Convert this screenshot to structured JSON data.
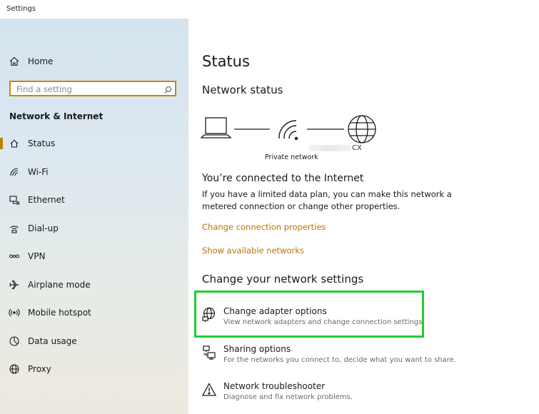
{
  "window": {
    "title": "Settings"
  },
  "sidebar": {
    "home_label": "Home",
    "search_placeholder": "Find a setting",
    "section_heading": "Network & Internet",
    "items": [
      {
        "label": "Status",
        "icon": "home-status-icon",
        "active": true
      },
      {
        "label": "Wi-Fi",
        "icon": "wifi-icon"
      },
      {
        "label": "Ethernet",
        "icon": "ethernet-icon"
      },
      {
        "label": "Dial-up",
        "icon": "dialup-icon"
      },
      {
        "label": "VPN",
        "icon": "vpn-icon"
      },
      {
        "label": "Airplane mode",
        "icon": "airplane-icon"
      },
      {
        "label": "Mobile hotspot",
        "icon": "hotspot-icon"
      },
      {
        "label": "Data usage",
        "icon": "data-usage-icon"
      },
      {
        "label": "Proxy",
        "icon": "globe-icon"
      }
    ]
  },
  "main": {
    "title": "Status",
    "network_status_heading": "Network status",
    "network_name_suffix": "CX",
    "network_type": "Private network",
    "connected_heading": "You’re connected to the Internet",
    "connected_desc": "If you have a limited data plan, you can make this network a metered connection or change other properties.",
    "link_change_connection": "Change connection properties",
    "link_show_networks": "Show available networks",
    "change_settings_heading": "Change your network settings",
    "options": [
      {
        "title": "Change adapter options",
        "desc": "View network adapters and change connection settings.",
        "icon": "adapter-icon"
      },
      {
        "title": "Sharing options",
        "desc": "For the networks you connect to, decide what you want to share.",
        "icon": "sharing-icon"
      },
      {
        "title": "Network troubleshooter",
        "desc": "Diagnose and fix network problems.",
        "icon": "warning-icon"
      }
    ]
  },
  "colors": {
    "accent": "#c77d00",
    "link": "#b8730a",
    "highlight": "#22cc33"
  }
}
